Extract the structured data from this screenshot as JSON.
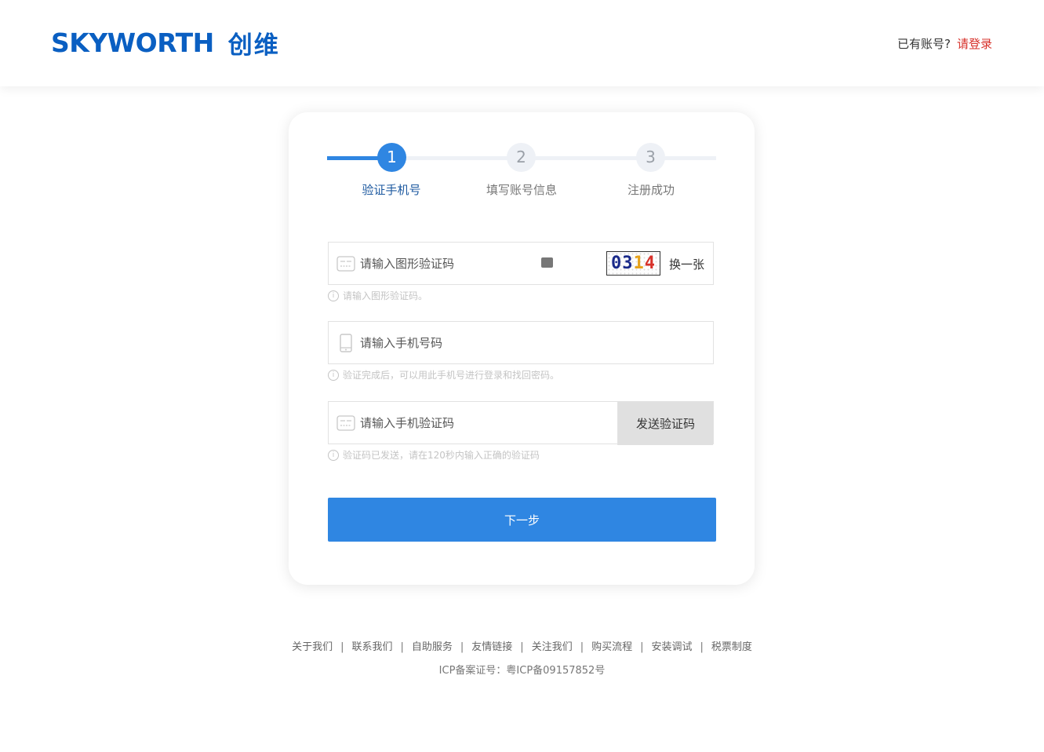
{
  "header": {
    "logo_en": "SKYWORTH",
    "logo_cn": "创维",
    "have_account": "已有账号?",
    "login_link": "请登录"
  },
  "steps": [
    {
      "number": "1",
      "label": "验证手机号",
      "active": true
    },
    {
      "number": "2",
      "label": "填写账号信息",
      "active": false
    },
    {
      "number": "3",
      "label": "注册成功",
      "active": false
    }
  ],
  "form": {
    "captcha": {
      "placeholder": "请输入图形验证码",
      "code": "0314",
      "refresh_label": "换一张",
      "hint": "请输入图形验证码。"
    },
    "phone": {
      "placeholder": "请输入手机号码",
      "hint": "验证完成后，可以用此手机号进行登录和找回密码。"
    },
    "sms": {
      "placeholder": "请输入手机验证码",
      "send_label": "发送验证码",
      "hint": "验证码已发送，请在120秒内输入正确的验证码"
    },
    "next_label": "下一步"
  },
  "footer": {
    "links": [
      "关于我们",
      "联系我们",
      "自助服务",
      "友情链接",
      "关注我们",
      "购买流程",
      "安装调试",
      "税票制度"
    ],
    "separator": "|",
    "icp": "ICP备案证号：粤ICP备09157852号"
  },
  "colors": {
    "brand_blue": "#0a5fc2",
    "primary": "#2f86e2",
    "login_red": "#d7312a"
  }
}
